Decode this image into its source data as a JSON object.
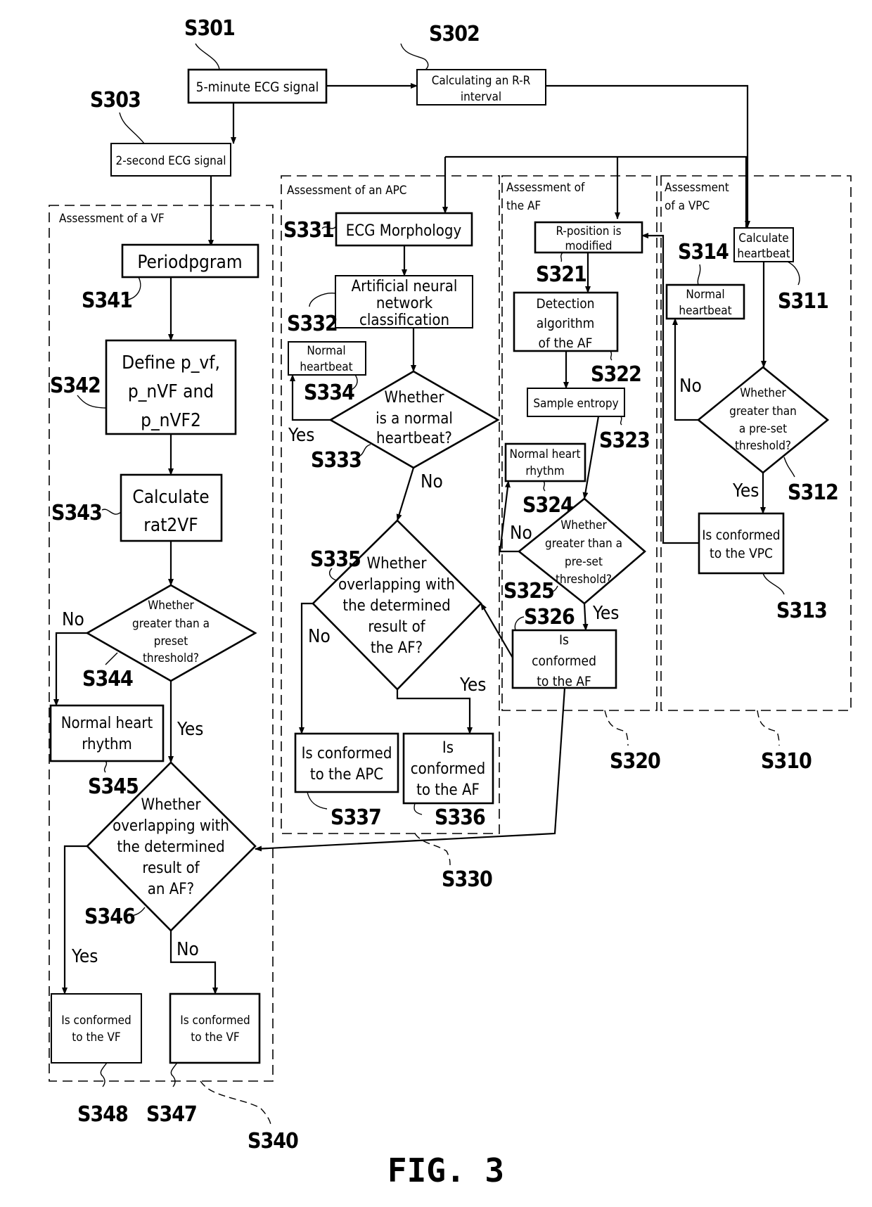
{
  "figure": {
    "caption": "FIG. 3"
  },
  "groups": {
    "vf": {
      "title": "Assessment of a VF",
      "ref": "S340"
    },
    "apc": {
      "title": "Assessment of an APC",
      "ref": "S330"
    },
    "af": {
      "title_lines": [
        "Assessment of",
        "the AF"
      ],
      "ref": "S320"
    },
    "vpc": {
      "title_lines": [
        "Assessment",
        "of a VPC"
      ],
      "ref": "S310"
    }
  },
  "nodes": {
    "S301": {
      "ref": "S301",
      "lines": [
        "5-minute ECG signal"
      ]
    },
    "S302": {
      "ref": "S302",
      "lines": [
        "Calculating an R-R",
        "interval"
      ]
    },
    "S303": {
      "ref": "S303",
      "lines": [
        "2-second ECG signal"
      ]
    },
    "S311": {
      "ref": "S311",
      "lines": [
        "Calculate",
        "heartbeat"
      ]
    },
    "S312": {
      "ref": "S312",
      "lines": [
        "Whether",
        "greater than",
        "a pre-set",
        "threshold?"
      ]
    },
    "S313": {
      "ref": "S313",
      "lines": [
        "Is conformed",
        "to the VPC"
      ]
    },
    "S314": {
      "ref": "S314",
      "lines": [
        "Normal",
        "heartbeat"
      ]
    },
    "S321": {
      "ref": "S321",
      "lines": [
        "R-position is",
        "modified"
      ]
    },
    "S322": {
      "ref": "S322",
      "lines": [
        "Detection",
        "algorithm",
        "of the AF"
      ]
    },
    "S323": {
      "ref": "S323",
      "lines": [
        "Sample entropy"
      ]
    },
    "S324": {
      "ref": "S324",
      "lines": [
        "Normal heart",
        "rhythm"
      ]
    },
    "S325": {
      "ref": "S325",
      "lines": [
        "Whether",
        "greater than a",
        "pre-set",
        "threshold?"
      ]
    },
    "S326": {
      "ref": "S326",
      "lines": [
        "Is",
        "conformed",
        "to the AF"
      ]
    },
    "S331": {
      "ref": "S331",
      "lines": [
        "ECG Morphology"
      ]
    },
    "S332": {
      "ref": "S332",
      "lines": [
        "Artificial neural",
        "network",
        "classification"
      ]
    },
    "S333": {
      "ref": "S333",
      "lines": [
        "Whether",
        "is a normal",
        "heartbeat?"
      ]
    },
    "S334": {
      "ref": "S334",
      "lines": [
        "Normal",
        "heartbeat"
      ]
    },
    "S335": {
      "ref": "S335",
      "lines": [
        "Whether",
        "overlapping with",
        "the determined",
        "result of",
        "the AF?"
      ]
    },
    "S336": {
      "ref": "S336",
      "lines": [
        "Is",
        "conformed",
        "to the AF"
      ]
    },
    "S337": {
      "ref": "S337",
      "lines": [
        "Is conformed",
        "to the APC"
      ]
    },
    "S341": {
      "ref": "S341",
      "lines": [
        "Periodpgram"
      ]
    },
    "S342": {
      "ref": "S342",
      "lines": [
        "Define p_vf,",
        "p_nVF and",
        "p_nVF2"
      ]
    },
    "S343": {
      "ref": "S343",
      "lines": [
        "Calculate",
        "rat2VF"
      ]
    },
    "S344": {
      "ref": "S344",
      "lines": [
        "Whether",
        "greater than a",
        "preset",
        "threshold?"
      ]
    },
    "S345": {
      "ref": "S345",
      "lines": [
        "Normal heart",
        "rhythm"
      ]
    },
    "S346": {
      "ref": "S346",
      "lines": [
        "Whether",
        "overlapping with",
        "the determined",
        "result of",
        "an AF?"
      ]
    },
    "S347": {
      "ref": "S347",
      "lines": [
        "Is conformed",
        "to the VF"
      ]
    },
    "S348": {
      "ref": "S348",
      "lines": [
        "Is conformed",
        "to the VF"
      ]
    }
  },
  "branch_labels": {
    "yes": "Yes",
    "no": "No"
  }
}
